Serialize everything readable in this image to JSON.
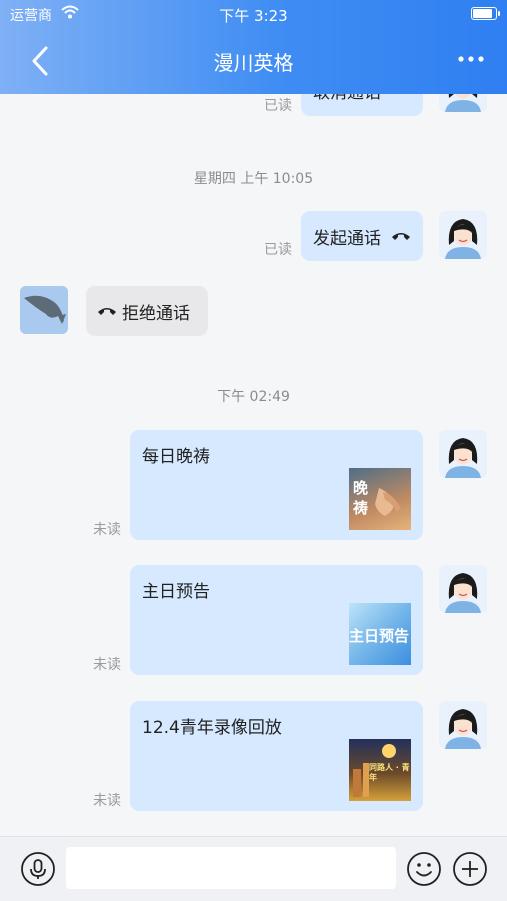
{
  "status": {
    "carrier": "运营商",
    "time": "下午 3:23"
  },
  "nav": {
    "title": "漫川英格"
  },
  "messages": {
    "prev_call": {
      "text": "取消通话",
      "read": "已读"
    },
    "ts1": "星期四 上午 10:05",
    "call_start": {
      "text": "发起通话",
      "read": "已读"
    },
    "call_reject": {
      "text": "拒绝通话"
    },
    "ts2": "下午 02:49",
    "cards": [
      {
        "title": "每日晚祷",
        "read": "未读",
        "thumb_text": "晚祷"
      },
      {
        "title": "主日预告",
        "read": "未读",
        "thumb_text": "主日预告"
      },
      {
        "title": "12.4青年录像回放",
        "read": "未读",
        "thumb_text": "同路人 · 青年"
      }
    ]
  },
  "input": {
    "placeholder": ""
  },
  "icons": [
    "back-icon",
    "more-icon",
    "phone-icon",
    "microphone-icon",
    "emoji-icon",
    "plus-icon",
    "wifi-icon",
    "battery-icon"
  ],
  "colors": {
    "header_start": "#7fb0f5",
    "header_end": "#2f7ff2",
    "self_bubble": "#d6e9ff",
    "other_bubble": "#e8e8ea"
  }
}
